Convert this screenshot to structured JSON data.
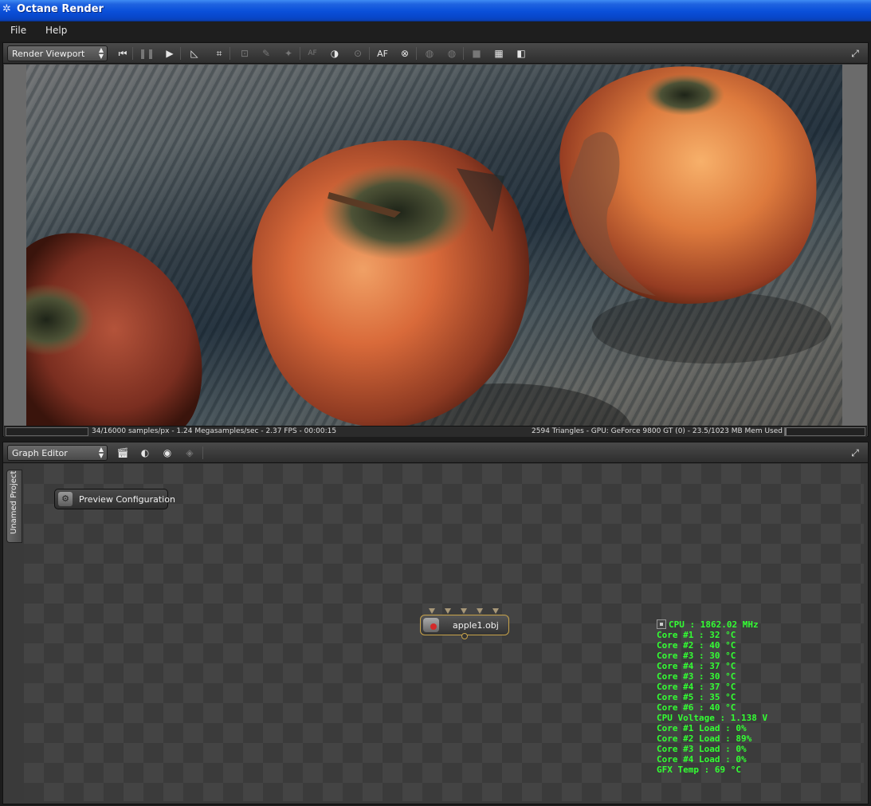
{
  "window": {
    "title": "Octane Render",
    "icon": "octane-icon"
  },
  "menu": {
    "items": [
      "File",
      "Help"
    ]
  },
  "render_panel": {
    "selector": "Render Viewport",
    "toolbar_icons": [
      "rewind-icon",
      "pause-icon",
      "play-icon",
      "region-icon",
      "focus-icon",
      "camera-icon",
      "pick-icon",
      "pick-material-icon",
      "autofocus-pick-icon",
      "white-balance-icon",
      "pick-focus-icon",
      "autofocus-icon",
      "stereo-icon",
      "lock-icon",
      "unlock-icon",
      "display-icon",
      "checker-icon",
      "alpha-icon"
    ],
    "autofocus_label": "AF",
    "af_small_label": "AF",
    "status_left": "34/16000 samples/px - 1.24 Megasamples/sec - 2.37 FPS - 00:00:15",
    "status_right": "2594 Triangles - GPU: GeForce 9800 GT (0) - 23.5/1023 MB Mem Used",
    "sample_progress": 0.002,
    "memory_used_fraction": 0.023
  },
  "graph_panel": {
    "selector": "Graph Editor",
    "toolbar_icons": [
      "clapper-icon",
      "mesh-icon",
      "material-icon",
      "render-target-icon"
    ],
    "project_tab": "Unamed Project",
    "preview_node": "Preview Configuration",
    "obj_node": "apple1.obj"
  },
  "sensors": [
    "CPU : 1862.02 MHz",
    "Core #1 : 32 °C",
    "Core #2 : 40 °C",
    "Core #3 : 30 °C",
    "Core #4 : 37 °C",
    "Core #3 : 30 °C",
    "Core #4 : 37 °C",
    "Core #5 : 35 °C",
    "Core #6 : 40 °C",
    "CPU Voltage : 1.138 V",
    "Core #1 Load : 0%",
    "Core #2 Load : 89%",
    "Core #3 Load : 0%",
    "Core #4 Load : 0%",
    "GFX Temp : 69 °C"
  ],
  "colors": {
    "title_bar": "#0a4fd9",
    "sensor_text": "#33ff33",
    "node_border": "#c8a34a"
  }
}
